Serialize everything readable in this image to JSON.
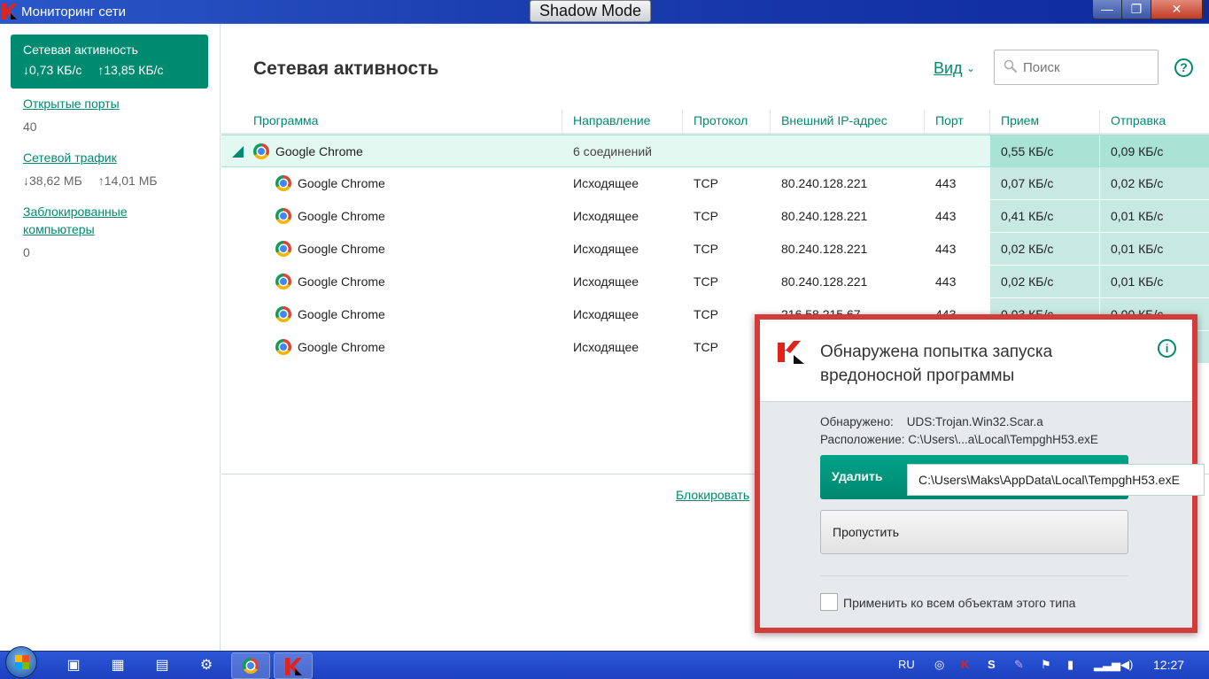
{
  "window": {
    "title": "Мониторинг сети",
    "shadow_mode": "Shadow Mode",
    "minimize": "—",
    "restore": "❐",
    "close": "✕"
  },
  "sidebar": {
    "active": {
      "label": "Сетевая активность",
      "down": "↓0,73 КБ/с",
      "up": "↑13,85 КБ/с"
    },
    "open_ports": {
      "label": "Открытые порты",
      "value": "40"
    },
    "traffic": {
      "label": "Сетевой трафик",
      "down": "↓38,62 МБ",
      "up": "↑14,01 МБ"
    },
    "blocked": {
      "label1": "Заблокированные",
      "label2": "компьютеры",
      "value": "0"
    }
  },
  "header": {
    "title": "Сетевая активность",
    "view": "Вид",
    "view_chevron": "⌄",
    "search_placeholder": "Поиск",
    "help": "?"
  },
  "table": {
    "columns": [
      "Программа",
      "Направление",
      "Протокол",
      "Внешний IP-адрес",
      "Порт",
      "Прием",
      "Отправка"
    ],
    "group": {
      "program": "Google Chrome",
      "connections": "6 соединений",
      "recv": "0,55 КБ/с",
      "send": "0,09 КБ/с"
    },
    "rows": [
      {
        "program": "Google Chrome",
        "direction": "Исходящее",
        "protocol": "TCP",
        "ip": "80.240.128.221",
        "port": "443",
        "recv": "0,07 КБ/с",
        "send": "0,02 КБ/с"
      },
      {
        "program": "Google Chrome",
        "direction": "Исходящее",
        "protocol": "TCP",
        "ip": "80.240.128.221",
        "port": "443",
        "recv": "0,41 КБ/с",
        "send": "0,01 КБ/с"
      },
      {
        "program": "Google Chrome",
        "direction": "Исходящее",
        "protocol": "TCP",
        "ip": "80.240.128.221",
        "port": "443",
        "recv": "0,02 КБ/с",
        "send": "0,01 КБ/с"
      },
      {
        "program": "Google Chrome",
        "direction": "Исходящее",
        "protocol": "TCP",
        "ip": "80.240.128.221",
        "port": "443",
        "recv": "0,02 КБ/с",
        "send": "0,01 КБ/с"
      },
      {
        "program": "Google Chrome",
        "direction": "Исходящее",
        "protocol": "TCP",
        "ip": "216.58.215.67",
        "port": "443",
        "recv": "0,03 КБ/с",
        "send": "0,00 КБ/с"
      },
      {
        "program": "Google Chrome",
        "direction": "Исходящее",
        "protocol": "TCP"
      }
    ],
    "block_link": "Блокировать"
  },
  "popup": {
    "title": "Обнаружена попытка запуска вредоносной программы",
    "info": "i",
    "detected_label": "Обнаружено:",
    "detected_value": "UDS:Trojan.Win32.Scar.a",
    "location_label": "Расположение:",
    "location_value": "C:\\Users\\...a\\Local\\TempghH53.exE",
    "delete_button": "Удалить",
    "tooltip": "C:\\Users\\Maks\\AppData\\Local\\TempghH53.exE",
    "skip_button": "Пропустить",
    "apply_all": "Применить ко всем объектам этого типа"
  },
  "taskbar": {
    "lang": "RU",
    "clock": "12:27"
  }
}
